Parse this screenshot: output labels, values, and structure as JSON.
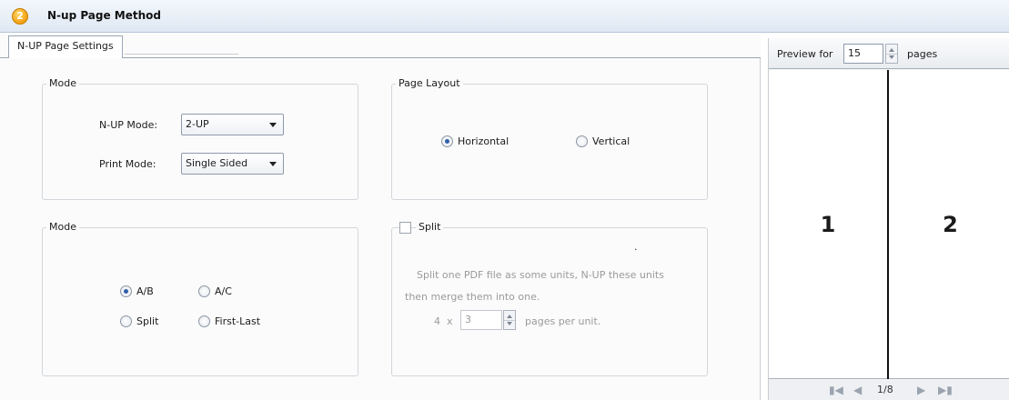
{
  "window": {
    "title": "N-up Page Method",
    "icon": "2"
  },
  "tabs": [
    {
      "label": "N-UP Page Settings"
    }
  ],
  "mode_group": {
    "legend": "Mode",
    "nup_mode_label": "N-UP Mode:",
    "nup_mode_value": "2-UP",
    "print_mode_label": "Print Mode:",
    "print_mode_value": "Single Sided"
  },
  "layout_group": {
    "legend": "Page Layout",
    "horizontal_label": "Horizontal",
    "vertical_label": "Vertical",
    "selected": "Horizontal"
  },
  "order_group": {
    "legend": "Mode",
    "options": [
      "A/B",
      "A/C",
      "Split",
      "First-Last"
    ],
    "selected": "A/B"
  },
  "split_group": {
    "legend": "Split",
    "checked": false,
    "desc_line1": "Split one PDF file as some units, N-UP these units",
    "desc_line2": "then merge them into one.",
    "prefix": "4  x",
    "value": "3",
    "suffix": "pages per unit.",
    "dot": "."
  },
  "preview": {
    "label": "Preview for",
    "pages_value": "15",
    "pages_suffix": "pages",
    "page_numbers": [
      "1",
      "2"
    ],
    "page_indicator": "1/8"
  },
  "nav_icons": [
    "first-page-icon",
    "prev-page-icon",
    "next-page-icon",
    "last-page-icon"
  ],
  "colors": {
    "radio_selected": "#2f5fa8",
    "title_icon": "#f3a010"
  }
}
